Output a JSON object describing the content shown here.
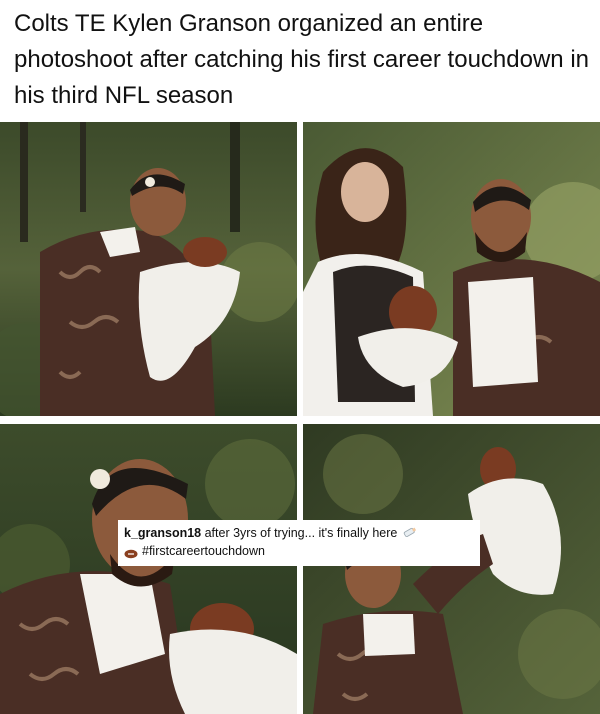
{
  "headline": "Colts TE Kylen Granson organized an entire photoshoot after catching his first career touchdown in his third NFL season",
  "caption": {
    "username": "k_granson18",
    "text": " after 3yrs of trying... it's finally here",
    "hashtag": "#firstcareertouchdown",
    "emoji_end": "baby-bottle-icon",
    "emoji_start": "football-icon"
  },
  "photos": [
    {
      "name": "man-cradling-football-photo"
    },
    {
      "name": "couple-with-football-photo"
    },
    {
      "name": "man-smiling-closeup-photo"
    },
    {
      "name": "man-lifting-football-photo"
    }
  ],
  "colors": {
    "foliage_dark": "#2f3a22",
    "foliage_light": "#6d7a45",
    "sweater": "#4a2e25",
    "blanket": "#f1efea",
    "football": "#7a3b22"
  }
}
